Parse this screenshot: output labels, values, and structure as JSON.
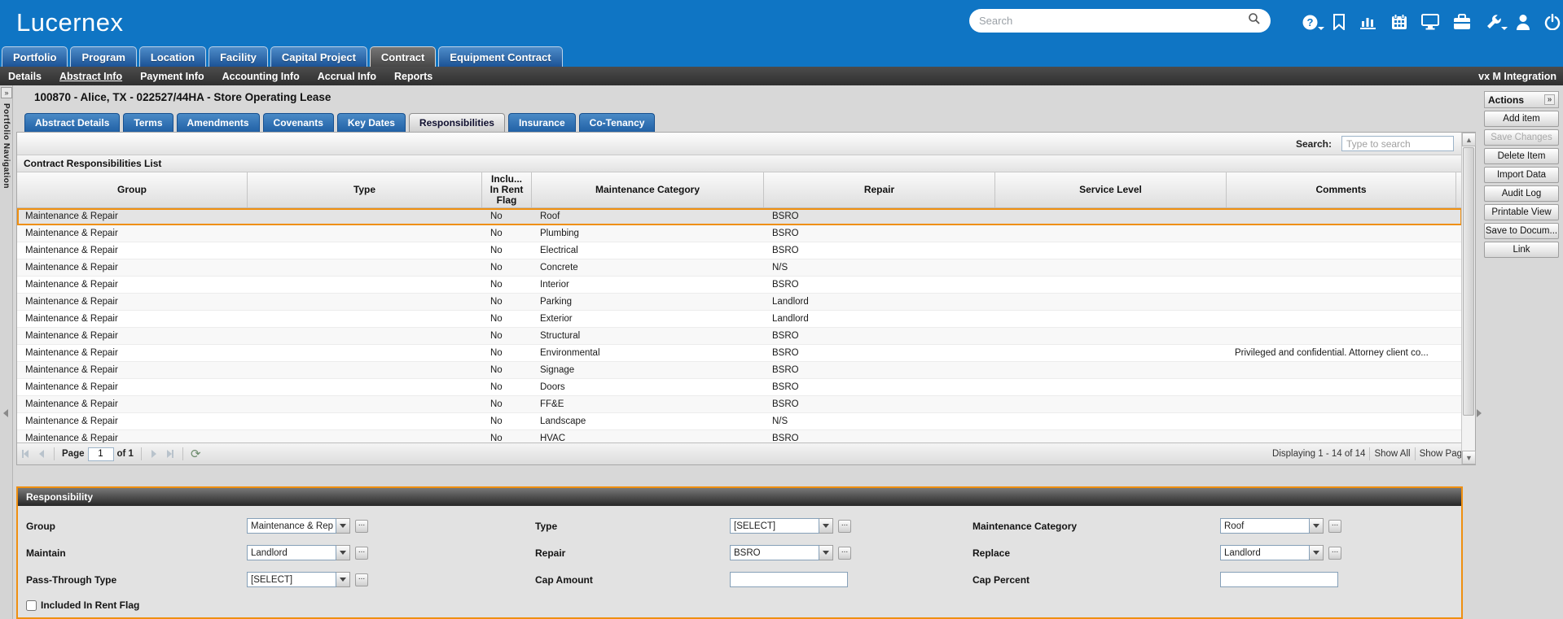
{
  "header": {
    "logo": "Lucernex",
    "search_placeholder": "Search",
    "icons": [
      "help",
      "bookmark",
      "bar-chart",
      "calendar",
      "monitor",
      "briefcase",
      "wrench",
      "user",
      "power"
    ]
  },
  "main_tabs": {
    "items": [
      {
        "label": "Portfolio",
        "active": false
      },
      {
        "label": "Program",
        "active": false
      },
      {
        "label": "Location",
        "active": false
      },
      {
        "label": "Facility",
        "active": false
      },
      {
        "label": "Capital Project",
        "active": false
      },
      {
        "label": "Contract",
        "active": true
      },
      {
        "label": "Equipment Contract",
        "active": false
      }
    ]
  },
  "sub_nav": {
    "items": [
      {
        "label": "Details",
        "active": false
      },
      {
        "label": "Abstract Info",
        "active": true
      },
      {
        "label": "Payment Info",
        "active": false
      },
      {
        "label": "Accounting Info",
        "active": false
      },
      {
        "label": "Accrual Info",
        "active": false
      },
      {
        "label": "Reports",
        "active": false
      }
    ],
    "right_label": "vx M Integration"
  },
  "left_rail": {
    "vertical_label": "Portfolio Navigation",
    "expand_glyph": "»"
  },
  "page": {
    "title": "100870 - Alice, TX - 022527/44HA - Store Operating Lease"
  },
  "inner_tabs": {
    "items": [
      {
        "label": "Abstract Details",
        "active": false
      },
      {
        "label": "Terms",
        "active": false
      },
      {
        "label": "Amendments",
        "active": false
      },
      {
        "label": "Covenants",
        "active": false
      },
      {
        "label": "Key Dates",
        "active": false
      },
      {
        "label": "Responsibilities",
        "active": true
      },
      {
        "label": "Insurance",
        "active": false
      },
      {
        "label": "Co-Tenancy",
        "active": false
      }
    ]
  },
  "list_panel": {
    "search_label": "Search:",
    "search_placeholder": "Type to search",
    "section_title": "Contract Responsibilities List",
    "columns": [
      "Group",
      "Type",
      "Inclu...\nIn Rent\nFlag",
      "Maintenance Category",
      "Repair",
      "Service Level",
      "Comments"
    ],
    "rows": [
      {
        "group": "Maintenance & Repair",
        "type": "",
        "in_rent_flag": "No",
        "maintenance_category": "Roof",
        "repair": "BSRO",
        "service_level": "",
        "comments": "",
        "selected": true
      },
      {
        "group": "Maintenance & Repair",
        "type": "",
        "in_rent_flag": "No",
        "maintenance_category": "Plumbing",
        "repair": "BSRO",
        "service_level": "",
        "comments": "",
        "selected": false
      },
      {
        "group": "Maintenance & Repair",
        "type": "",
        "in_rent_flag": "No",
        "maintenance_category": "Electrical",
        "repair": "BSRO",
        "service_level": "",
        "comments": "",
        "selected": false
      },
      {
        "group": "Maintenance & Repair",
        "type": "",
        "in_rent_flag": "No",
        "maintenance_category": "Concrete",
        "repair": "N/S",
        "service_level": "",
        "comments": "",
        "selected": false
      },
      {
        "group": "Maintenance & Repair",
        "type": "",
        "in_rent_flag": "No",
        "maintenance_category": "Interior",
        "repair": "BSRO",
        "service_level": "",
        "comments": "",
        "selected": false
      },
      {
        "group": "Maintenance & Repair",
        "type": "",
        "in_rent_flag": "No",
        "maintenance_category": "Parking",
        "repair": "Landlord",
        "service_level": "",
        "comments": "",
        "selected": false
      },
      {
        "group": "Maintenance & Repair",
        "type": "",
        "in_rent_flag": "No",
        "maintenance_category": "Exterior",
        "repair": "Landlord",
        "service_level": "",
        "comments": "",
        "selected": false
      },
      {
        "group": "Maintenance & Repair",
        "type": "",
        "in_rent_flag": "No",
        "maintenance_category": "Structural",
        "repair": "BSRO",
        "service_level": "",
        "comments": "",
        "selected": false
      },
      {
        "group": "Maintenance & Repair",
        "type": "",
        "in_rent_flag": "No",
        "maintenance_category": "Environmental",
        "repair": "BSRO",
        "service_level": "",
        "comments": "Privileged and confidential. Attorney client co...",
        "selected": false
      },
      {
        "group": "Maintenance & Repair",
        "type": "",
        "in_rent_flag": "No",
        "maintenance_category": "Signage",
        "repair": "BSRO",
        "service_level": "",
        "comments": "",
        "selected": false
      },
      {
        "group": "Maintenance & Repair",
        "type": "",
        "in_rent_flag": "No",
        "maintenance_category": "Doors",
        "repair": "BSRO",
        "service_level": "",
        "comments": "",
        "selected": false
      },
      {
        "group": "Maintenance & Repair",
        "type": "",
        "in_rent_flag": "No",
        "maintenance_category": "FF&E",
        "repair": "BSRO",
        "service_level": "",
        "comments": "",
        "selected": false
      },
      {
        "group": "Maintenance & Repair",
        "type": "",
        "in_rent_flag": "No",
        "maintenance_category": "Landscape",
        "repair": "N/S",
        "service_level": "",
        "comments": "",
        "selected": false
      },
      {
        "group": "Maintenance & Repair",
        "type": "",
        "in_rent_flag": "No",
        "maintenance_category": "HVAC",
        "repair": "BSRO",
        "service_level": "",
        "comments": "",
        "selected": false
      }
    ],
    "pagination": {
      "page_label": "Page",
      "page_value": "1",
      "of_label": "of 1",
      "displaying": "Displaying 1 - 14 of 14",
      "show_all": "Show All",
      "show_page": "Show Pag"
    }
  },
  "actions": {
    "title": "Actions",
    "collapse_glyph": "»",
    "buttons": [
      {
        "label": "Add item",
        "enabled": true
      },
      {
        "label": "Save Changes",
        "enabled": false
      },
      {
        "label": "Delete Item",
        "enabled": true
      },
      {
        "label": "Import Data",
        "enabled": true
      },
      {
        "label": "Audit Log",
        "enabled": true
      },
      {
        "label": "Printable View",
        "enabled": true
      },
      {
        "label": "Save to Docum...",
        "enabled": true
      },
      {
        "label": "Link",
        "enabled": true
      }
    ]
  },
  "form": {
    "title": "Responsibility",
    "fields": [
      {
        "label": "Group",
        "kind": "select",
        "value": "Maintenance & Rep",
        "col": 1,
        "row": 1,
        "focused": true
      },
      {
        "label": "Type",
        "kind": "select",
        "value": "[SELECT]",
        "col": 2,
        "row": 1,
        "focused": false
      },
      {
        "label": "Maintenance Category",
        "kind": "select",
        "value": "Roof",
        "col": 3,
        "row": 1,
        "focused": false
      },
      {
        "label": "Maintain",
        "kind": "select",
        "value": "Landlord",
        "col": 1,
        "row": 2,
        "focused": false
      },
      {
        "label": "Repair",
        "kind": "select",
        "value": "BSRO",
        "col": 2,
        "row": 2,
        "focused": false
      },
      {
        "label": "Replace",
        "kind": "select",
        "value": "Landlord",
        "col": 3,
        "row": 2,
        "focused": false
      },
      {
        "label": "Pass-Through Type",
        "kind": "select",
        "value": "[SELECT]",
        "col": 1,
        "row": 3,
        "focused": false
      },
      {
        "label": "Cap Amount",
        "kind": "text",
        "value": "",
        "col": 2,
        "row": 3,
        "focused": false
      },
      {
        "label": "Cap Percent",
        "kind": "text",
        "value": "",
        "col": 3,
        "row": 3,
        "focused": false
      }
    ],
    "checkbox": {
      "label": "Included In Rent Flag",
      "checked": false
    }
  },
  "colors": {
    "header_blue": "#0f75c4",
    "selection_orange": "#ef8f10",
    "nav_dark": "#3a3a3a"
  }
}
